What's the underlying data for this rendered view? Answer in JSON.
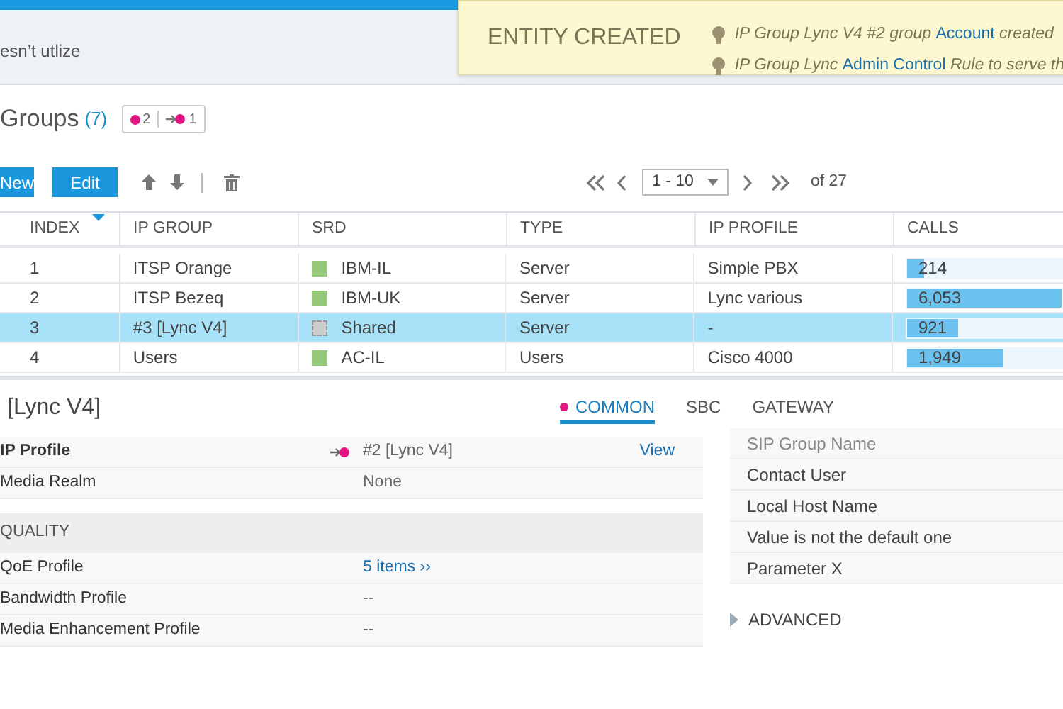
{
  "top_strip": {
    "text": "esn’t utlize"
  },
  "notification": {
    "title": "ENTITY CREATED",
    "lines": [
      [
        {
          "text": "IP Group Lync V4 #2 group ",
          "link": false
        },
        {
          "text": "Account",
          "link": true
        },
        {
          "text": " created",
          "link": false
        }
      ],
      [
        {
          "text": "IP Group Lync ",
          "link": false
        },
        {
          "text": "Admin Control",
          "link": true
        },
        {
          "text": " Rule to serve th",
          "link": false
        }
      ]
    ]
  },
  "header": {
    "title": "Groups",
    "count": "(7)",
    "badges": [
      {
        "kind": "dot",
        "value": "2"
      },
      {
        "kind": "arrow",
        "value": "1"
      }
    ]
  },
  "toolbar": {
    "buttons": [
      "New",
      "Edit"
    ],
    "pager": {
      "range": "1 - 10",
      "total": "of 27"
    }
  },
  "table": {
    "columns": [
      "INDEX",
      "IP GROUP",
      "SRD",
      "TYPE",
      "IP PROFILE",
      "CALLS"
    ],
    "rows": [
      {
        "index": "1",
        "ip_group": "ITSP Orange",
        "srd": "IBM-IL",
        "srd_shared": false,
        "type": "Server",
        "ip_profile": "Simple PBX",
        "calls": "214",
        "level": 0.11,
        "selected": false
      },
      {
        "index": "2",
        "ip_group": "ITSP Bezeq",
        "srd": "IBM-UK",
        "srd_shared": false,
        "type": "Server",
        "ip_profile": "Lync various",
        "calls": "6,053",
        "level": 1.0,
        "selected": false
      },
      {
        "index": "3",
        "ip_group": "#3 [Lync V4]",
        "srd": "Shared",
        "srd_shared": true,
        "type": "Server",
        "ip_profile": "-",
        "calls": "921",
        "level": 0.33,
        "selected": true
      },
      {
        "index": "4",
        "ip_group": "Users",
        "srd": "AC-IL",
        "srd_shared": false,
        "type": "Users",
        "ip_profile": "Cisco 4000",
        "calls": "1,949",
        "level": 0.62,
        "selected": false
      }
    ]
  },
  "detail": {
    "title": "[Lync V4]",
    "tabs": [
      {
        "label": "COMMON",
        "selected": true,
        "modified": true
      },
      {
        "label": "SBC",
        "selected": false,
        "modified": false
      },
      {
        "label": "GATEWAY",
        "selected": false,
        "modified": false
      }
    ],
    "left_rows": [
      {
        "kind": "field",
        "label": "IP Profile",
        "value": "#2 [Lync V4]",
        "linked": true,
        "action": "View"
      },
      {
        "kind": "field",
        "label": "Media Realm",
        "value": "None"
      },
      {
        "kind": "section",
        "label": "QUALITY"
      },
      {
        "kind": "link",
        "label": "QoE Profile",
        "value": "5 items ››"
      },
      {
        "kind": "field",
        "label": "Bandwidth Profile",
        "value": "--"
      },
      {
        "kind": "field",
        "label": "Media Enhancement Profile",
        "value": "--"
      }
    ],
    "right_rows": [
      "SIP Group Name",
      "Contact User",
      "Local Host Name",
      "Value is not the default one",
      "Parameter X"
    ],
    "advanced": {
      "label": "ADVANCED",
      "expanded": false
    }
  }
}
